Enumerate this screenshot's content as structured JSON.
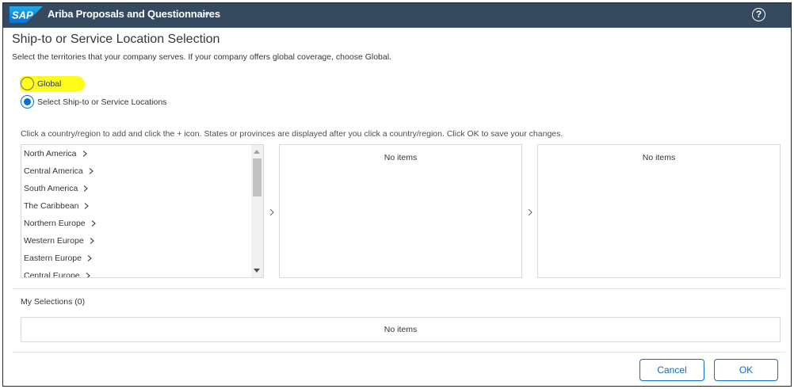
{
  "shell": {
    "brand": "SAP",
    "app_title": "Ariba Proposals and Questionnaires",
    "help_glyph": "?",
    "colors": {
      "shell_bg": "#354a5f",
      "brand_blue": "#0a6ed1"
    },
    "icons": {
      "title_menu": "chevron-down-icon",
      "help": "help-icon"
    }
  },
  "page": {
    "title": "Ship-to or Service Location Selection",
    "description": "Select the territories that your company serves. If your company offers global coverage, choose Global."
  },
  "coverage": {
    "options": [
      {
        "label": "Global",
        "selected": false,
        "highlighted": true
      },
      {
        "label": "Select Ship-to or Service Locations",
        "selected": true
      }
    ],
    "highlight_color": "#fdfd19"
  },
  "hint": "Click a country/region to add and click the + icon. States or provinces are displayed after you click a country/region. Click OK to save your changes.",
  "regions": {
    "items": [
      "North America",
      "Central America",
      "South America",
      "The Caribbean",
      "Northern Europe",
      "Western Europe",
      "Eastern Europe",
      "Central Europe"
    ]
  },
  "countries": {
    "empty_text": "No items"
  },
  "provinces": {
    "empty_text": "No items"
  },
  "my_selections": {
    "label": "My Selections (0)",
    "empty_text": "No items"
  },
  "footer": {
    "cancel_label": "Cancel",
    "ok_label": "OK"
  }
}
